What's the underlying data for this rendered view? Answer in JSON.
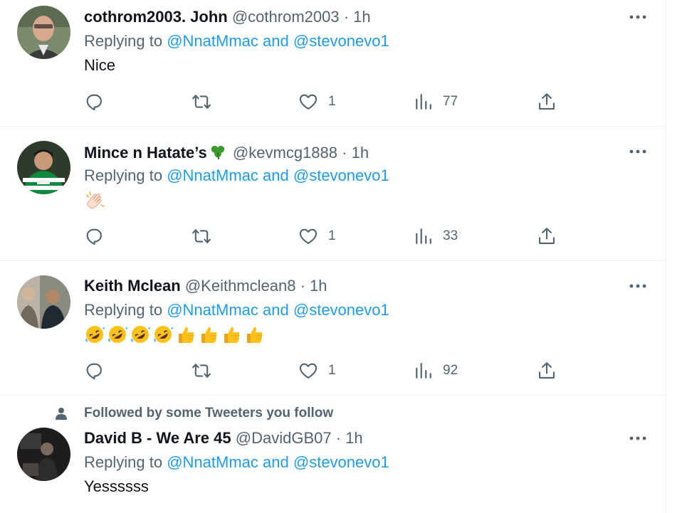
{
  "tweets": [
    {
      "name": "cothrom2003. John",
      "handle": "@cothrom2003",
      "dot": "·",
      "time": "1h",
      "replying_prefix": "Replying to",
      "mention1": "@NnatMmac",
      "and": "and",
      "mention2": "@stevonevo1",
      "text": "Nice",
      "likes": "1",
      "views": "77"
    },
    {
      "name": "Mince n Hatate’s",
      "name_emoji": "shamrock",
      "handle": "@kevmcg1888",
      "dot": "·",
      "time": "1h",
      "replying_prefix": "Replying to",
      "mention1": "@NnatMmac",
      "and": "and",
      "mention2": "@stevonevo1",
      "text_emoji": [
        "clapping-hands"
      ],
      "likes": "1",
      "views": "33"
    },
    {
      "name": "Keith Mclean",
      "handle": "@Keithmclean8",
      "dot": "·",
      "time": "1h",
      "replying_prefix": "Replying to",
      "mention1": "@NnatMmac",
      "and": "and",
      "mention2": "@stevonevo1",
      "text_emoji": [
        "rofl",
        "rofl",
        "rofl",
        "rofl",
        "thumbs-up",
        "thumbs-up",
        "thumbs-up",
        "thumbs-up"
      ],
      "likes": "1",
      "views": "92"
    },
    {
      "social_context": "Followed by some Tweeters you follow",
      "name": "David B - We Are 45",
      "handle": "@DavidGB07",
      "dot": "·",
      "time": "1h",
      "replying_prefix": "Replying to",
      "mention1": "@NnatMmac",
      "and": "and",
      "mention2": "@stevonevo1",
      "text": "Yessssss"
    }
  ],
  "icons": {
    "reply": "reply-icon",
    "retweet": "retweet-icon",
    "like": "heart-icon",
    "views": "views-icon",
    "share": "share-icon",
    "more": "more-icon",
    "person": "person-icon"
  },
  "colors": {
    "text": "#0f1419",
    "secondary": "#536471",
    "link": "#1d9bf0",
    "divider": "#eff3f4"
  }
}
